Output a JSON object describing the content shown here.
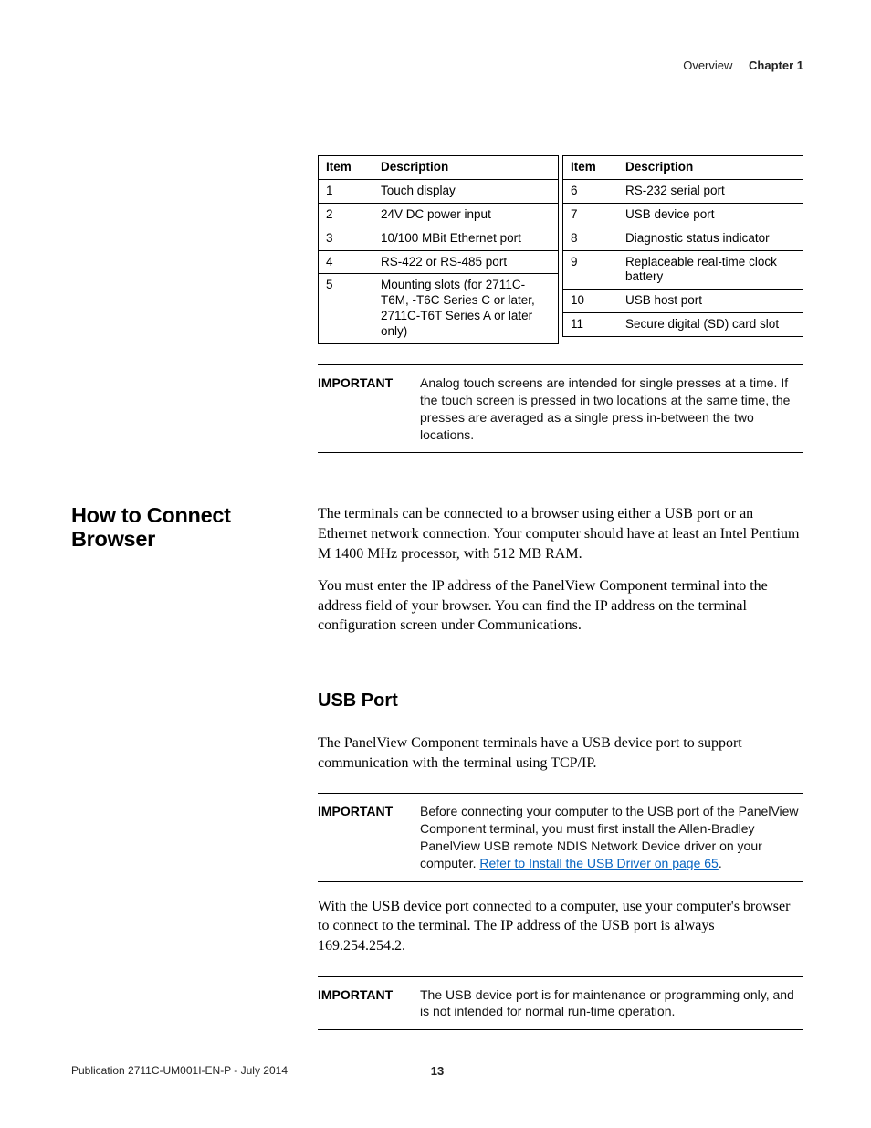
{
  "header": {
    "section": "Overview",
    "chapter": "Chapter 1"
  },
  "table": {
    "col_headers": {
      "item": "Item",
      "desc": "Description"
    },
    "left": [
      {
        "n": "1",
        "d": "Touch display"
      },
      {
        "n": "2",
        "d": "24V DC power input"
      },
      {
        "n": "3",
        "d": "10/100 MBit Ethernet port"
      },
      {
        "n": "4",
        "d": "RS-422 or RS-485 port"
      },
      {
        "n": "5",
        "d": "Mounting slots (for 2711C-T6M, -T6C Series C or later,  2711C-T6T Series A or later  only)"
      }
    ],
    "right": [
      {
        "n": "6",
        "d": "RS-232 serial port"
      },
      {
        "n": "7",
        "d": "USB device port"
      },
      {
        "n": "8",
        "d": "Diagnostic status indicator"
      },
      {
        "n": "9",
        "d": "Replaceable real-time clock battery"
      },
      {
        "n": "10",
        "d": "USB host port"
      },
      {
        "n": "11",
        "d": "Secure digital (SD) card slot"
      }
    ]
  },
  "callouts": {
    "label": "IMPORTANT",
    "touch": "Analog touch screens are intended for single presses at a time. If the touch screen is pressed in two locations at the same time, the presses are averaged as a single press in-between the two locations.",
    "usb_driver_pre": "Before connecting your computer to the USB port of the PanelView Component terminal, you must first install the Allen-Bradley PanelView USB remote NDIS Network Device driver on your computer. ",
    "usb_driver_link": "Refer to Install the USB Driver on page 65",
    "usb_driver_post": ".",
    "usb_maint": "The USB device port is for maintenance or programming only, and is not intended for normal run-time operation."
  },
  "browser": {
    "heading": "How to Connect Browser",
    "p1": "The terminals can be connected to a browser using either a USB port or an Ethernet network connection. Your computer should have at least an Intel Pentium M 1400 MHz processor, with 512 MB RAM.",
    "p2": "You must enter the IP address of the PanelView Component terminal into the address field of your browser. You can find the IP address on the terminal configuration screen under Communications."
  },
  "usb": {
    "heading": "USB Port",
    "p1": "The PanelView Component terminals have a USB device port to support communication with the terminal using TCP/IP.",
    "p2": "With the USB device port connected to a computer, use your computer's browser to connect to the terminal. The IP address of the USB port is always 169.254.254.2."
  },
  "footer": {
    "pub": "Publication 2711C-UM001I-EN-P - July 2014",
    "page": "13"
  }
}
